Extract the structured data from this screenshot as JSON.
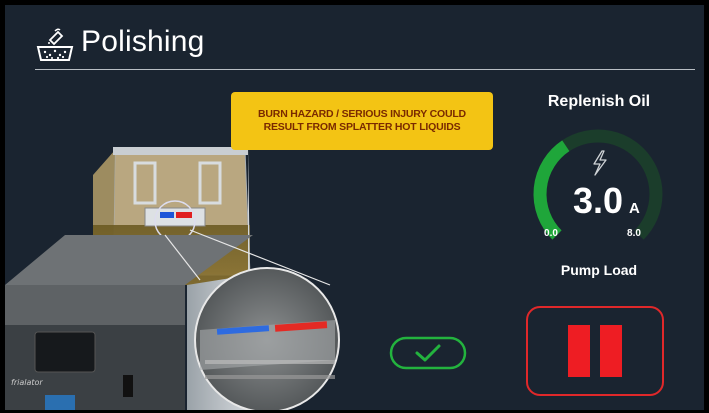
{
  "header": {
    "title": "Polishing",
    "icon": "polishing-icon"
  },
  "warning": {
    "text": "BURN HAZARD / SERIOUS INJURY COULD\nRESULT FROM SPLATTER HOT LIQUIDS",
    "color": "#f3c414"
  },
  "gauge": {
    "title": "Replenish Oil",
    "value": "3.0",
    "unit": "A",
    "min": "0.0",
    "max": "8.0",
    "caption": "Pump Load",
    "level": 0.375,
    "icon": "lightning-icon",
    "fill_color": "#1fa63a",
    "track_color": "#1b3d2b"
  },
  "controls": {
    "confirm_icon": "checkmark-icon",
    "pause_icon": "pause-icon",
    "confirm_color": "#23b33e",
    "pause_color": "#ee1d23"
  },
  "illustration": {
    "brand": "frialator"
  }
}
